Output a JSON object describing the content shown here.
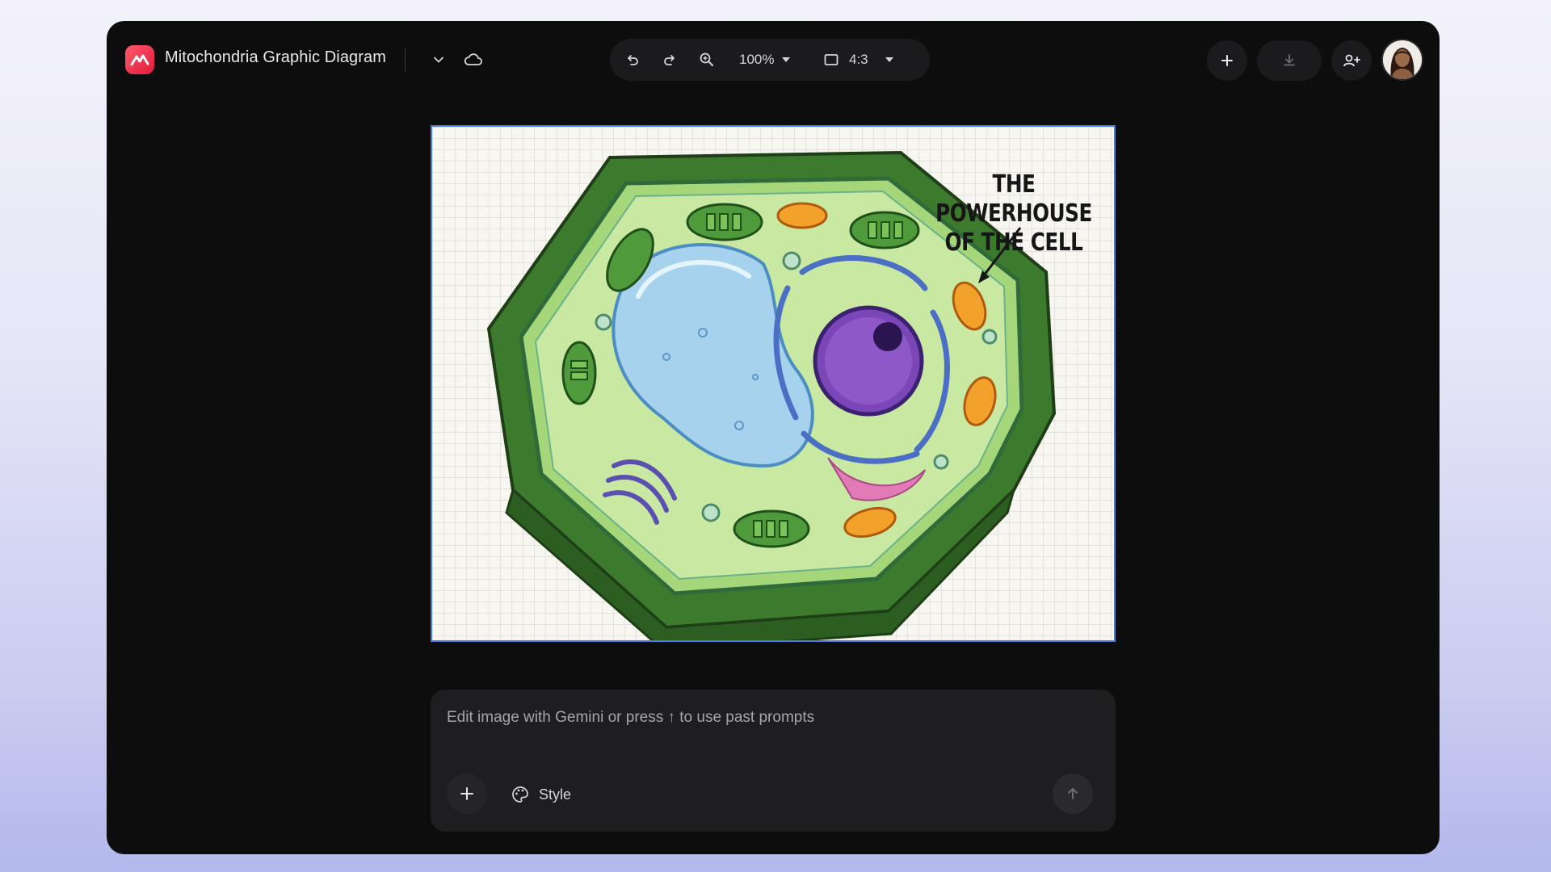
{
  "header": {
    "doc_title": "Mitochondria Graphic Diagram",
    "title_menu_icon": "chevron-down-icon",
    "cloud_icon": "cloud-icon"
  },
  "toolbar": {
    "undo_icon": "undo-icon",
    "redo_icon": "redo-icon",
    "zoom_icon": "zoom-in-icon",
    "zoom_level": "100%",
    "aspect_icon": "aspect-ratio-icon",
    "aspect_ratio": "4:3"
  },
  "actions": {
    "add_icon": "plus-icon",
    "download_icon": "download-icon",
    "share_icon": "add-person-icon",
    "avatar": "user-avatar"
  },
  "canvas": {
    "caption_line1": "THE POWERHOUSE",
    "caption_line2": "OF THE CELL"
  },
  "prompt": {
    "placeholder": "Edit image with Gemini or press ↑ to use past prompts",
    "add_icon": "plus-icon",
    "style_label": "Style",
    "style_icon": "palette-icon",
    "send_icon": "arrow-up-icon"
  },
  "colors": {
    "window_bg": "#0d0d0e",
    "canvas_border": "#4a7de0",
    "brand": "#e0193a"
  }
}
